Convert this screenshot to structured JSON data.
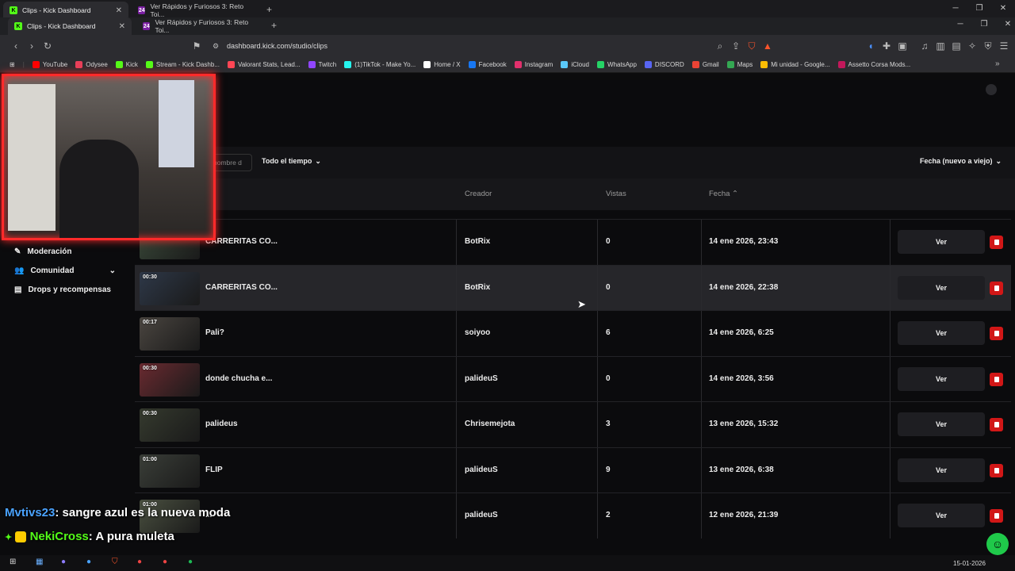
{
  "browser": {
    "tabs_row1": [
      {
        "label": "Clips - Kick Dashboard"
      },
      {
        "label": "Ver Rápidos y Furiosos 3: Reto Toi..."
      }
    ],
    "tabs_row2": [
      {
        "label": "Clips - Kick Dashboard"
      },
      {
        "label": "Ver Rápidos y Furiosos 3: Reto Toi..."
      }
    ],
    "url": "dashboard.kick.com/studio/clips",
    "bookmarks": [
      {
        "label": "YouTube",
        "color": "#ff0000"
      },
      {
        "label": "Odysee",
        "color": "#e8405a"
      },
      {
        "label": "Kick",
        "color": "#53fc18"
      },
      {
        "label": "Stream - Kick Dashb...",
        "color": "#53fc18"
      },
      {
        "label": "Valorant Stats, Lead...",
        "color": "#ff4655"
      },
      {
        "label": "Twitch",
        "color": "#9146ff"
      },
      {
        "label": "(1)TikTok - Make Yo...",
        "color": "#25f4ee"
      },
      {
        "label": "Home / X",
        "color": "#ffffff"
      },
      {
        "label": "Facebook",
        "color": "#1877f2"
      },
      {
        "label": "Instagram",
        "color": "#e1306c"
      },
      {
        "label": "iCloud",
        "color": "#5ac8fa"
      },
      {
        "label": "WhatsApp",
        "color": "#25d366"
      },
      {
        "label": "DISCORD",
        "color": "#5865f2"
      },
      {
        "label": "Gmail",
        "color": "#ea4335"
      },
      {
        "label": "Maps",
        "color": "#34a853"
      },
      {
        "label": "Mi unidad - Google...",
        "color": "#fbbc04"
      },
      {
        "label": "Assetto Corsa Mods...",
        "color": "#c2185b"
      }
    ]
  },
  "filters": {
    "search_placeholder": "nombre d",
    "time_filter": "Todo el tiempo",
    "sort": "Fecha (nuevo a viejo)"
  },
  "table": {
    "headers": {
      "creator": "Creador",
      "views": "Vistas",
      "date": "Fecha"
    },
    "view_label": "Ver",
    "rows": [
      {
        "duration": "",
        "title": "CARRERITAS CO...",
        "creator": "BotRix",
        "views": "0",
        "date": "14 ene 2026, 23:43",
        "thumb": "#3a4a3a"
      },
      {
        "duration": "00:30",
        "title": "CARRERITAS CO...",
        "creator": "BotRix",
        "views": "0",
        "date": "14 ene 2026, 22:38",
        "thumb": "#2e3848"
      },
      {
        "duration": "00:17",
        "title": "Pali?",
        "creator": "soiyoo",
        "views": "6",
        "date": "14 ene 2026, 6:25",
        "thumb": "#4a4540"
      },
      {
        "duration": "00:30",
        "title": "donde chucha e...",
        "creator": "palideuS",
        "views": "0",
        "date": "14 ene 2026, 3:56",
        "thumb": "#6a2a30"
      },
      {
        "duration": "00:30",
        "title": "palideus",
        "creator": "Chrisemejota",
        "views": "3",
        "date": "13 ene 2026, 15:32",
        "thumb": "#353a2e"
      },
      {
        "duration": "01:00",
        "title": "FLIP",
        "creator": "palideuS",
        "views": "9",
        "date": "13 ene 2026, 6:38",
        "thumb": "#3a3e38"
      },
      {
        "duration": "01:00",
        "title": "...",
        "creator": "palideuS",
        "views": "2",
        "date": "12 ene 2026, 21:39",
        "thumb": "#4a5040"
      }
    ]
  },
  "sidebar": {
    "items": [
      {
        "label": "Moderación"
      },
      {
        "label": "Comunidad"
      },
      {
        "label": "Drops y recompensas"
      }
    ]
  },
  "chat": [
    {
      "user": "Mvtivs23",
      "text": ": sangre azul es la nueva moda",
      "color": "#4aa3ff"
    },
    {
      "user": "NekiCross",
      "text": ": A pura muleta",
      "color": "#53fc18"
    }
  ],
  "taskbar": {
    "date": "15-01-2026"
  },
  "colors": {
    "accent": "#53fc18",
    "danger": "#d11717"
  }
}
